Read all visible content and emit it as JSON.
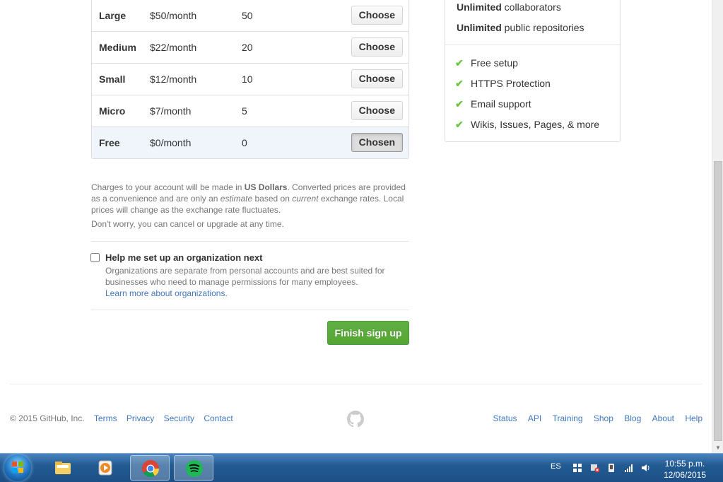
{
  "plans": [
    {
      "name": "Large",
      "price": "$50/month",
      "repos": "50",
      "button": "Choose"
    },
    {
      "name": "Medium",
      "price": "$22/month",
      "repos": "20",
      "button": "Choose"
    },
    {
      "name": "Small",
      "price": "$12/month",
      "repos": "10",
      "button": "Choose"
    },
    {
      "name": "Micro",
      "price": "$7/month",
      "repos": "5",
      "button": "Choose"
    },
    {
      "name": "Free",
      "price": "$0/month",
      "repos": "0",
      "button": "Chosen"
    }
  ],
  "currency_note": {
    "prefix": "Charges to your account will be made in ",
    "currency": "US Dollars",
    "middle1": ". Converted prices are provided as a convenience and are only an ",
    "estimate": "estimate",
    "middle2": " based on ",
    "current": "current",
    "suffix": " exchange rates. Local prices will change as the exchange rate fluctuates."
  },
  "cancel_note": "Don't worry, you can cancel or upgrade at any time.",
  "organization": {
    "label": "Help me set up an organization next",
    "description": "Organizations are separate from personal accounts and are best suited for businesses who need to manage permissions for many employees.",
    "link": "Learn more about organizations."
  },
  "finish_button": "Finish sign up",
  "features": {
    "top": [
      {
        "bold": "Unlimited",
        "text": " collaborators"
      },
      {
        "bold": "Unlimited",
        "text": " public repositories"
      }
    ],
    "items": [
      "Free setup",
      "HTTPS Protection",
      "Email support",
      "Wikis, Issues, Pages, & more"
    ]
  },
  "footer": {
    "copyright": "© 2015 GitHub, Inc.",
    "left_links": [
      "Terms",
      "Privacy",
      "Security",
      "Contact"
    ],
    "right_links": [
      "Status",
      "API",
      "Training",
      "Shop",
      "Blog",
      "About",
      "Help"
    ]
  },
  "taskbar": {
    "lang": "ES",
    "time": "10:55 p.m.",
    "date": "12/06/2015"
  },
  "colors": {
    "accent_link": "#4078c0",
    "success_green": "#55a532",
    "check_green": "#6cc644"
  }
}
